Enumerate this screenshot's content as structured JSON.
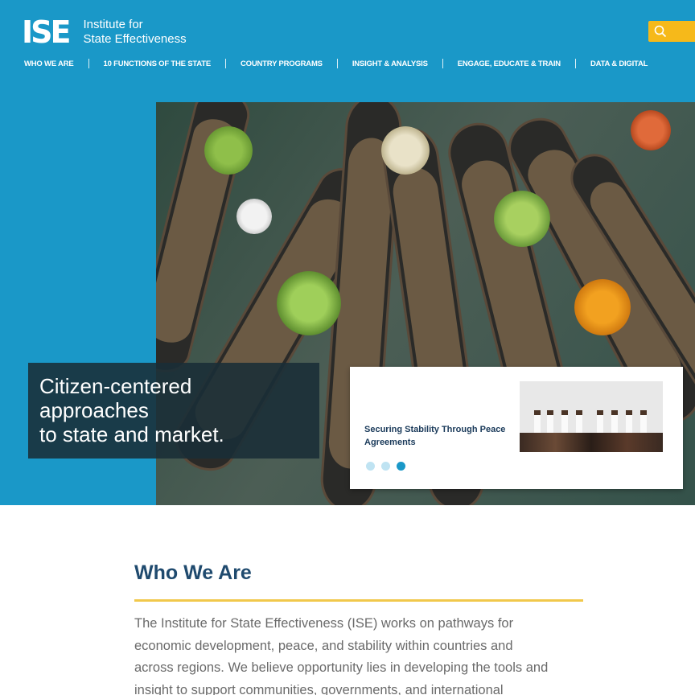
{
  "header": {
    "logo_mark": "ISE",
    "logo_line1": "Institute for",
    "logo_line2": "State Effectiveness",
    "search_icon": "search-icon"
  },
  "nav": {
    "items": [
      {
        "label": "WHO WE ARE"
      },
      {
        "label": "10 FUNCTIONS OF THE STATE"
      },
      {
        "label": "COUNTRY PROGRAMS"
      },
      {
        "label": "INSIGHT & ANALYSIS"
      },
      {
        "label": "ENGAGE, EDUCATE & TRAIN"
      },
      {
        "label": "DATA & DIGITAL"
      }
    ]
  },
  "hero": {
    "tagline_lines": [
      "Citizen-centered",
      "approaches",
      "to state and market."
    ],
    "card": {
      "title": "Securing Stability Through Peace Agreements",
      "slides_total": 3,
      "active_slide": 3
    }
  },
  "about": {
    "title": "Who We Are",
    "body": "The Institute for State Effectiveness (ISE) works on pathways for economic development, peace, and stability within countries and across regions. We believe opportunity lies in developing the tools and insight to support communities, governments, and international"
  },
  "colors": {
    "brand_blue": "#1a98c8",
    "accent_yellow": "#f6b91a",
    "heading_navy": "#1f4a6e",
    "rule_gold": "#f1c84b"
  }
}
